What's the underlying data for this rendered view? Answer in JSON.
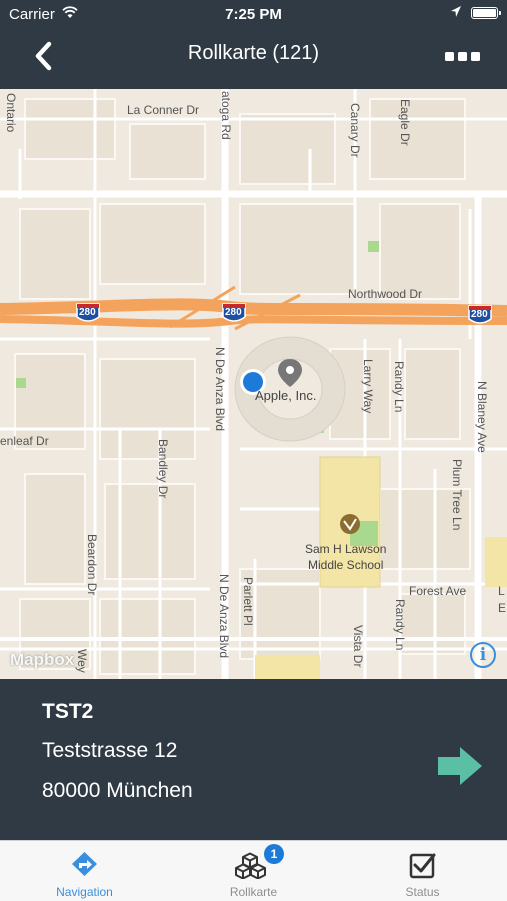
{
  "status_bar": {
    "carrier": "Carrier",
    "time": "7:25 PM"
  },
  "header": {
    "title": "Rollkarte (121)"
  },
  "map": {
    "attribution": "Mapbox",
    "info": "i",
    "labels": {
      "la_conner": "La Conner Dr",
      "ontario": "Ontario",
      "saratoga": "atoga Rd",
      "canary": "Canary Dr",
      "eagle": "Eagle Dr",
      "northwood": "Northwood Dr",
      "apple": "Apple, Inc.",
      "larry": "Larry Way",
      "randy1": "Randy Ln",
      "blaney": "N Blaney Ave",
      "enleaf": "enleaf Dr",
      "bandley": "Bandley Dr",
      "de_anza1": "N De Anza Blvd",
      "beardon": "Beardon Dr",
      "plum": "Plum Tree Ln",
      "lawson1": "Sam H Lawson",
      "lawson2": "Middle School",
      "forest": "Forest Ave",
      "parlett": "Parlett Pl",
      "de_anza2": "N De Anza Blvd",
      "vista": "Vista Dr",
      "randy2": "Randy Ln",
      "edge_l": "L",
      "edge_e": "E",
      "wey": "Wey",
      "shield": "280"
    }
  },
  "stop": {
    "code": "TST2",
    "street": "Teststrasse 12",
    "city": "80000 München"
  },
  "tabs": [
    {
      "label": "Navigation",
      "icon": "navigation-icon",
      "active": true
    },
    {
      "label": "Rollkarte",
      "icon": "cubes-icon",
      "badge": "1"
    },
    {
      "label": "Status",
      "icon": "checkbox-icon"
    }
  ],
  "colors": {
    "accent": "#3a8fdc",
    "panel": "#2f3a44",
    "highway": "#f4a35c",
    "go_arrow": "#5bbfa6"
  }
}
